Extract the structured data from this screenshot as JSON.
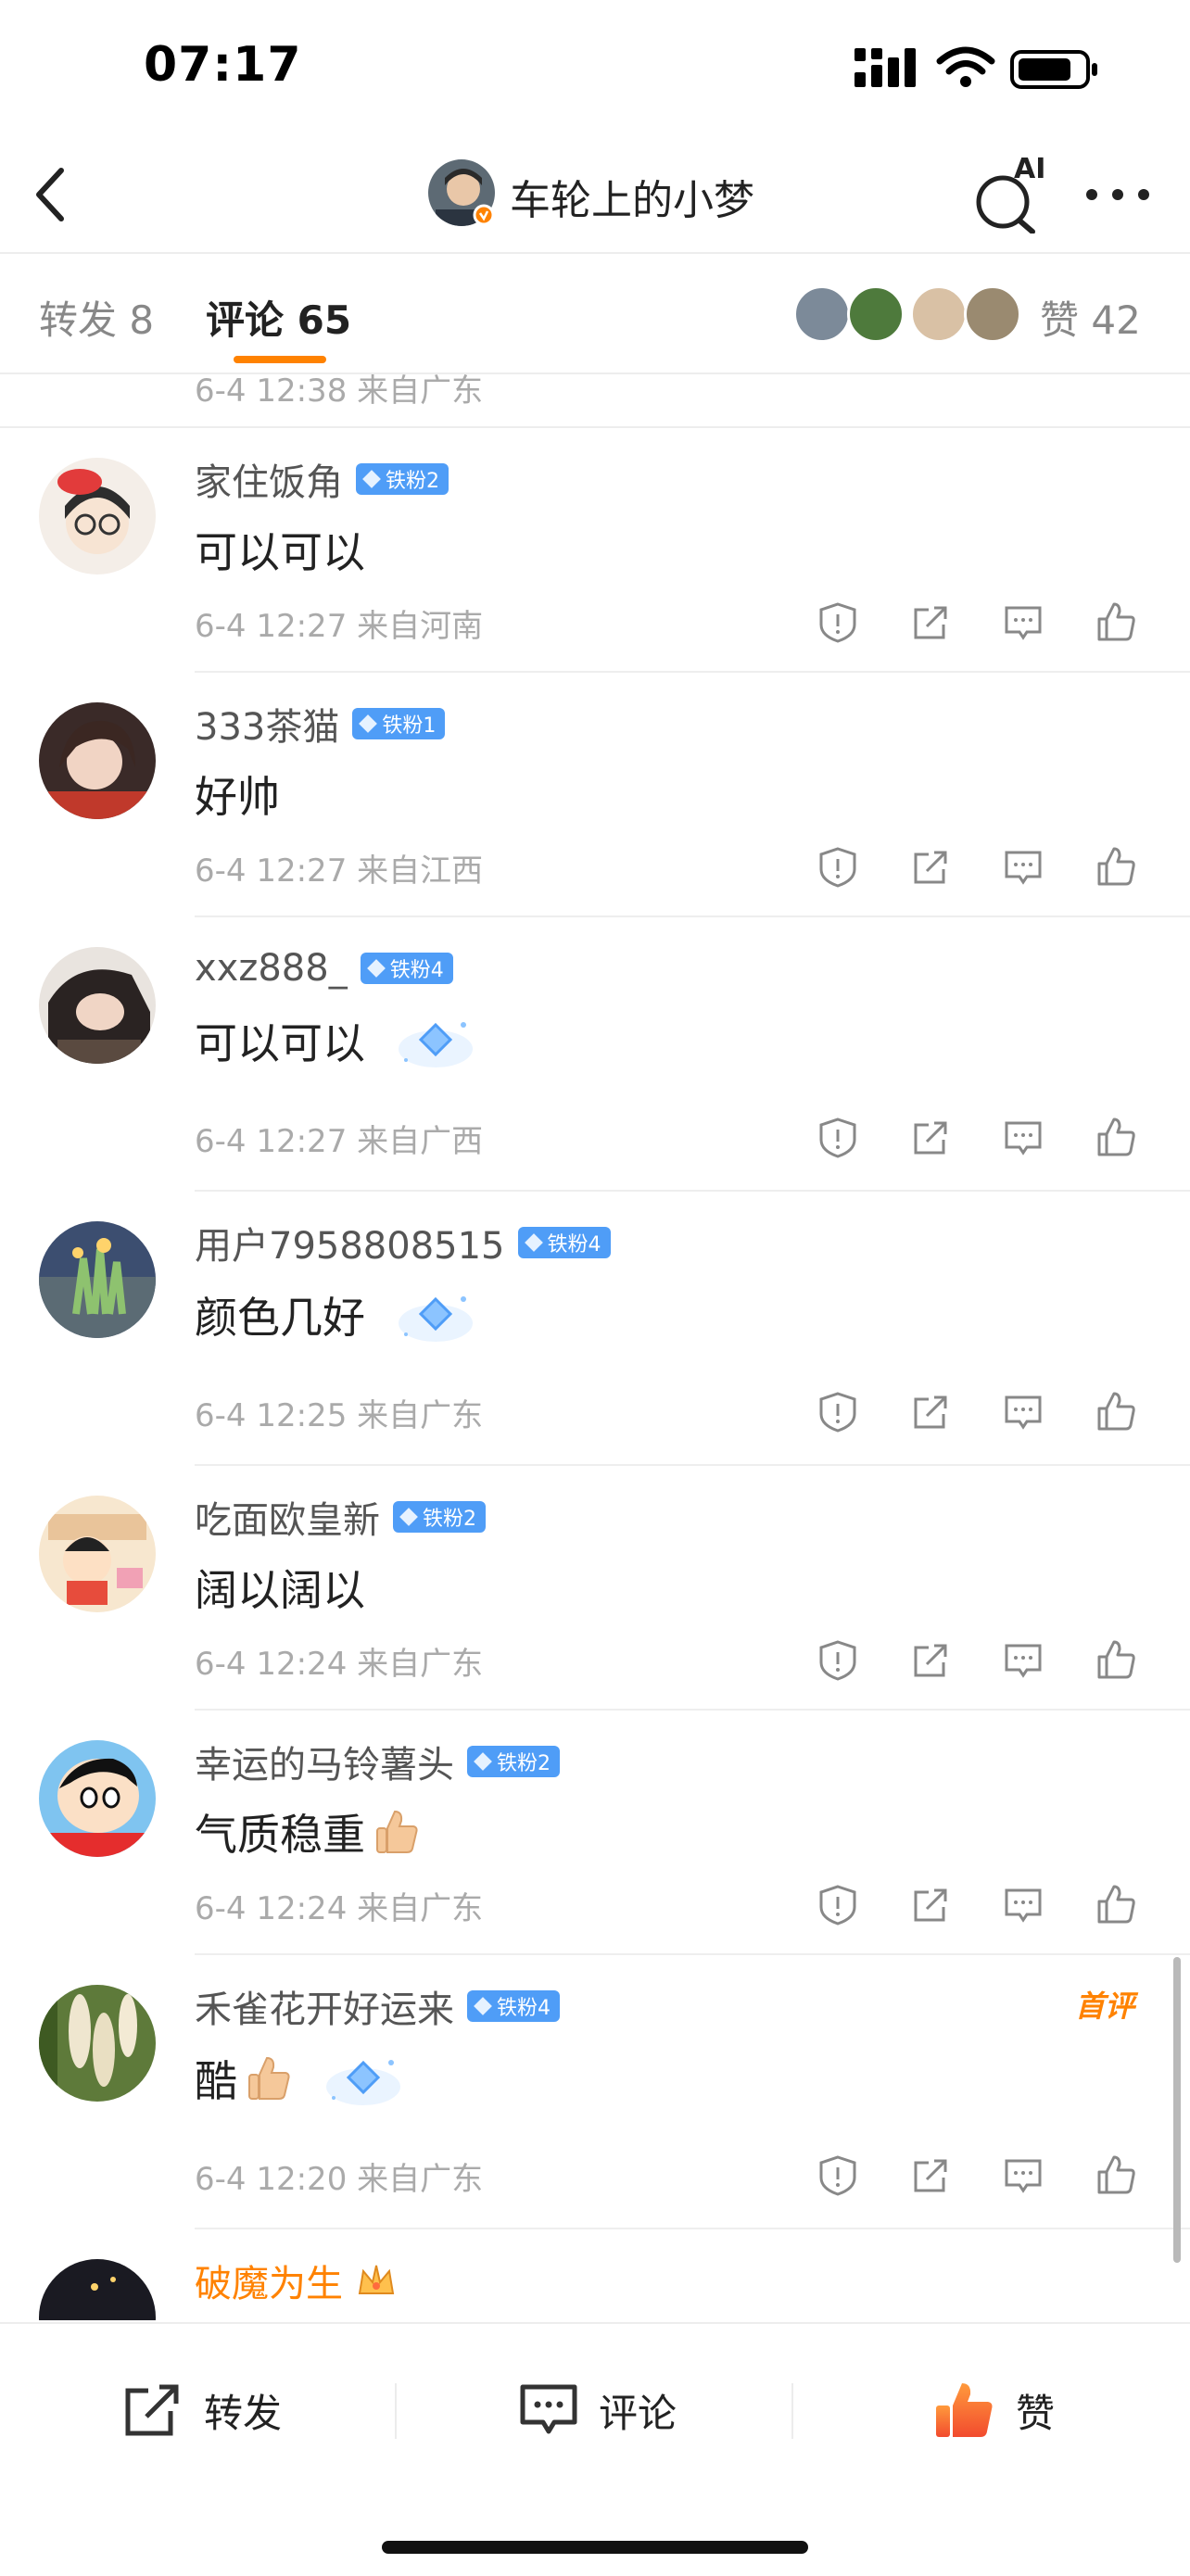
{
  "status_bar": {
    "time": "07:17"
  },
  "nav": {
    "title": "车轮上的小梦",
    "ai_label": "AI"
  },
  "tabs": {
    "repost": "转发 8",
    "comment": "评论 65",
    "like": "赞 42"
  },
  "partial_row": {
    "meta": "6-4 12:38 来自广东"
  },
  "comments": [
    {
      "name": "家住饭角",
      "badge": "铁粉2",
      "text": "可以可以",
      "meta": "6-4 12:27 来自河南"
    },
    {
      "name": "333茶猫",
      "badge": "铁粉1",
      "text": "好帅",
      "meta": "6-4 12:27 来自江西"
    },
    {
      "name": "xxz888_",
      "badge": "铁粉4",
      "text": "可以可以",
      "meta": "6-4 12:27 来自广西"
    },
    {
      "name": "用户7958808515",
      "badge": "铁粉4",
      "text": "颜色几好",
      "meta": "6-4 12:25 来自广东"
    },
    {
      "name": "吃面欧皇新",
      "badge": "铁粉2",
      "text": "阔以阔以",
      "meta": "6-4 12:24 来自广东"
    },
    {
      "name": "幸运的马铃薯头",
      "badge": "铁粉2",
      "text": "气质稳重",
      "meta": "6-4 12:24 来自广东"
    },
    {
      "name": "禾雀花开好运来",
      "badge": "铁粉4",
      "text": "酷",
      "meta": "6-4 12:20 来自广东",
      "tag": "首评"
    },
    {
      "name": "破魔为生"
    }
  ],
  "bottom_bar": {
    "repost": "转发",
    "comment": "评论",
    "like": "赞"
  },
  "colors": {
    "accent": "#ff8200",
    "badge": "#4f9df7",
    "meta": "#aaaaaa"
  },
  "icons": [
    "back-icon",
    "ai-search-icon",
    "more-icon",
    "report-icon",
    "share-icon",
    "reply-icon",
    "like-icon"
  ]
}
